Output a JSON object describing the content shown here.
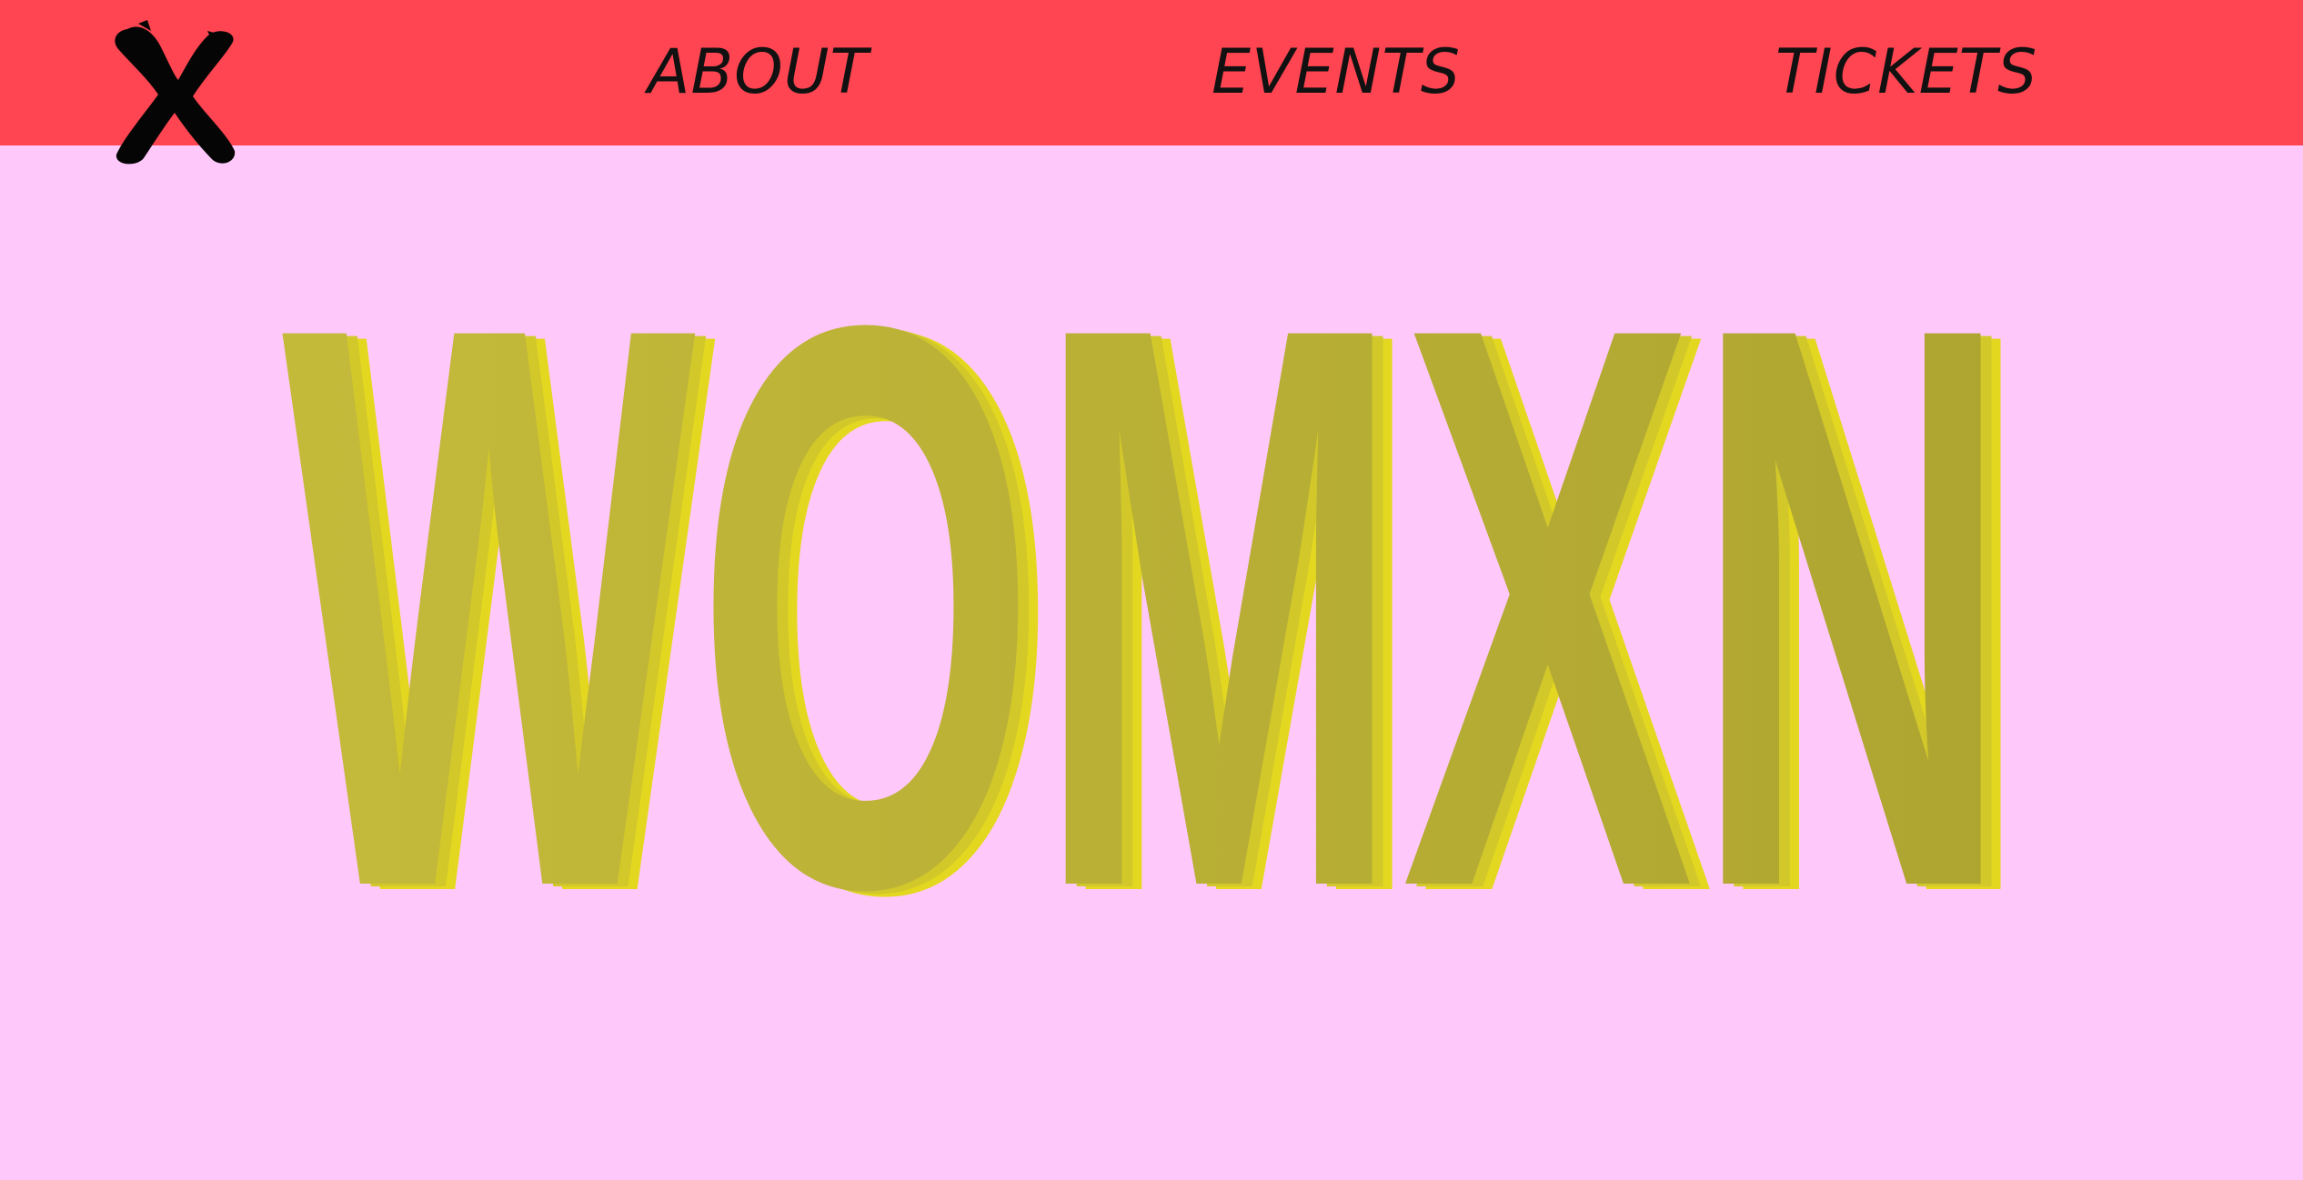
{
  "nav": {
    "logo_icon": "black-x-brush-icon",
    "items": [
      {
        "label": "ABOUT"
      },
      {
        "label": "EVENTS"
      },
      {
        "label": "TICKETS"
      }
    ]
  },
  "hero": {
    "title": "WOMXN"
  },
  "colors": {
    "background": "#ffc8fb",
    "navbar": "#ff4551",
    "nav_text": "#111111",
    "hero_face": "#b8ae33",
    "hero_side": "#d8cf22"
  }
}
